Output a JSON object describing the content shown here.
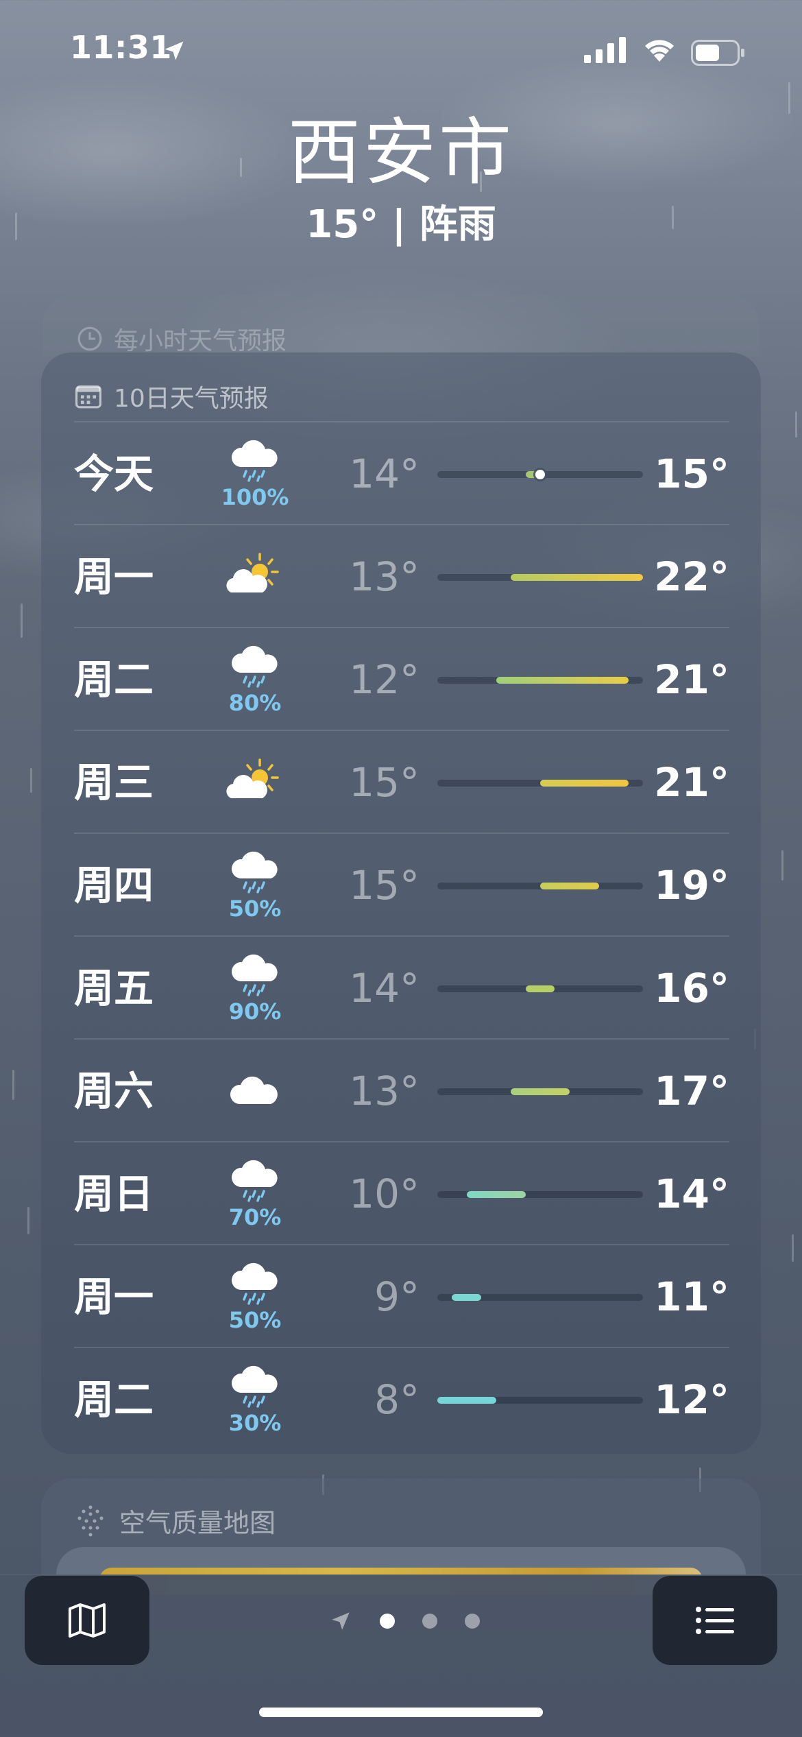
{
  "status_bar": {
    "time": "11:31"
  },
  "header": {
    "city": "西安市",
    "condition": "15° | 阵雨"
  },
  "hourly": {
    "title": "每小时天气预报"
  },
  "forecast": {
    "title": "10日天气预报",
    "scale_min": 8,
    "scale_max": 22,
    "current_temp": 15,
    "days": [
      {
        "day": "今天",
        "icon": "rain-cloud-icon",
        "precip": "100%",
        "low": "14°",
        "high": "15°",
        "low_val": 14,
        "high_val": 15,
        "color": "#a4c86a"
      },
      {
        "day": "周一",
        "icon": "partly-sunny-icon",
        "precip": "",
        "low": "13°",
        "high": "22°",
        "low_val": 13,
        "high_val": 22,
        "color": "linear-gradient(90deg,#b5cc60,#f2c941)"
      },
      {
        "day": "周二",
        "icon": "rain-cloud-icon",
        "precip": "80%",
        "low": "12°",
        "high": "21°",
        "low_val": 12,
        "high_val": 21,
        "color": "linear-gradient(90deg,#9fcf7a,#e9cc48)"
      },
      {
        "day": "周三",
        "icon": "partly-sunny-icon",
        "precip": "",
        "low": "15°",
        "high": "21°",
        "low_val": 15,
        "high_val": 21,
        "color": "linear-gradient(90deg,#d4cc52,#f0c640)"
      },
      {
        "day": "周四",
        "icon": "rain-cloud-icon",
        "precip": "50%",
        "low": "15°",
        "high": "19°",
        "low_val": 15,
        "high_val": 19,
        "color": "linear-gradient(90deg,#c6cf5a,#dfcc4a)"
      },
      {
        "day": "周五",
        "icon": "rain-cloud-icon",
        "precip": "90%",
        "low": "14°",
        "high": "16°",
        "low_val": 14,
        "high_val": 16,
        "color": "#b6d066"
      },
      {
        "day": "周六",
        "icon": "cloud-icon",
        "precip": "",
        "low": "13°",
        "high": "17°",
        "low_val": 13,
        "high_val": 17,
        "color": "linear-gradient(90deg,#a9d07e,#c4d062)"
      },
      {
        "day": "周日",
        "icon": "rain-cloud-icon",
        "precip": "70%",
        "low": "10°",
        "high": "14°",
        "low_val": 10,
        "high_val": 14,
        "color": "linear-gradient(90deg,#7fd8c4,#9fd3a2)"
      },
      {
        "day": "周一",
        "icon": "rain-cloud-icon",
        "precip": "50%",
        "low": "9°",
        "high": "11°",
        "low_val": 9,
        "high_val": 11,
        "color": "#7ad8d2"
      },
      {
        "day": "周二",
        "icon": "rain-cloud-icon",
        "precip": "30%",
        "low": "8°",
        "high": "12°",
        "low_val": 8,
        "high_val": 12,
        "color": "#74d6d6"
      }
    ]
  },
  "air_quality": {
    "title": "空气质量地图"
  }
}
